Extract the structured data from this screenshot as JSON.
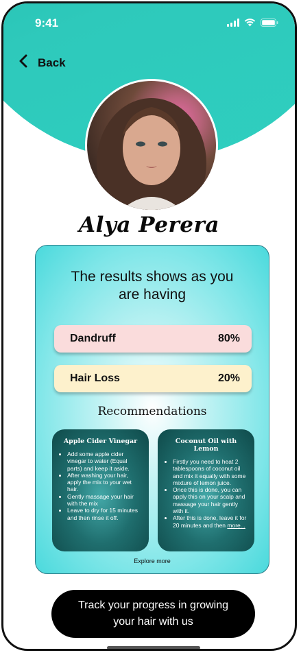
{
  "status_bar": {
    "time": "9:41"
  },
  "colors": {
    "accent": "#2ec9bb",
    "card_border": "#2d7d88",
    "dandruff_pill": "#fadcdc",
    "hairloss_pill": "#fdf1cc",
    "cta_background": "#000000"
  },
  "nav": {
    "back_label": "Back",
    "back_icon": "chevron-left-icon"
  },
  "profile": {
    "name": "Alya Perera",
    "avatar": "profile-photo"
  },
  "results": {
    "heading_line1": "The results shows as you",
    "heading_line2": "are having",
    "items": [
      {
        "label": "Dandruff",
        "value": "80%"
      },
      {
        "label": "Hair Loss",
        "value": "20%"
      }
    ]
  },
  "recommendations": {
    "heading": "Recommendations",
    "cards": [
      {
        "title": "Apple Cider Vinegar",
        "steps": [
          "Add some apple cider vinegar to water (Equal parts) and keep it aside.",
          "After washing your hair, apply the mix to your wet hair.",
          "Gently massage your hair with the mix",
          "Leave to dry for 15 minutes and then rinse it off."
        ]
      },
      {
        "title": "Coconut Oil with Lemon",
        "steps": [
          "Firstly you need to heat 2 tablespoons of coconut oil and mix it equally with some mixture of lemon juice.",
          "Once this is done, you can apply this on your scalp and massage your hair gently with it.",
          "After this is done, leave it for 20 minutes and then"
        ],
        "more_label": "more..."
      }
    ],
    "explore_label": "Explore more"
  },
  "cta": {
    "line1": "Track your progress in growing",
    "line2": "your hair with us"
  }
}
